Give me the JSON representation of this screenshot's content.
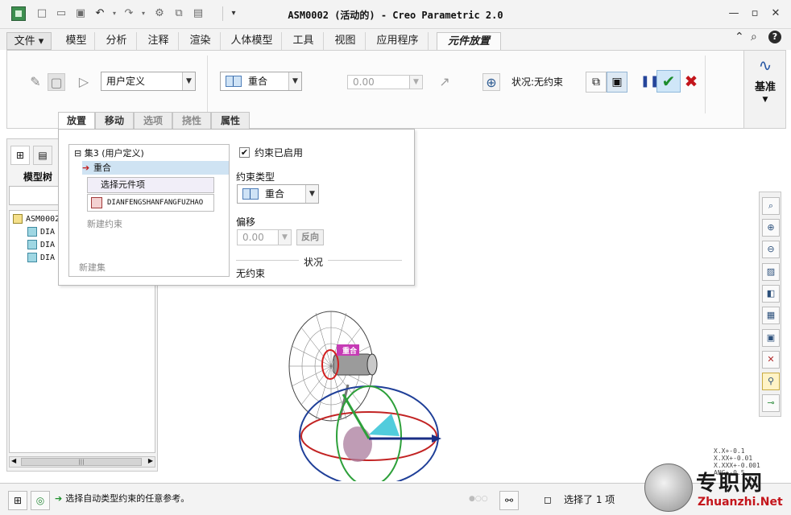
{
  "window": {
    "title": "ASM0002 (活动的) - Creo Parametric 2.0"
  },
  "ribbon_tabs": [
    {
      "label": "文件 ▾"
    },
    {
      "label": "模型"
    },
    {
      "label": "分析"
    },
    {
      "label": "注释"
    },
    {
      "label": "渲染"
    },
    {
      "label": "人体模型"
    },
    {
      "label": "工具"
    },
    {
      "label": "视图"
    },
    {
      "label": "应用程序"
    },
    {
      "label": "元件放置"
    }
  ],
  "ribbon": {
    "user_defined": "用户定义",
    "constraint_combo": "重合",
    "offset_value": "0.00",
    "status": "状况:无约束",
    "basis_label": "基准"
  },
  "sub_tabs": [
    {
      "label": "放置"
    },
    {
      "label": "移动"
    },
    {
      "label": "选项"
    },
    {
      "label": "挠性"
    },
    {
      "label": "属性"
    }
  ],
  "model_tree": {
    "title": "模型树",
    "root": "ASM0002",
    "items": [
      "DIA",
      "DIA",
      "DIA"
    ],
    "scroll_thumb": "|||"
  },
  "placement": {
    "set_header": "集3 (用户定义)",
    "selected_constraint": "重合",
    "pick_item": "选择元件项",
    "reference": "DIANFENGSHANFANGFUZHAO",
    "new_constraint": "新建约束",
    "new_set": "新建集",
    "enabled_label": "约束已启用",
    "type_label": "约束类型",
    "type_value": "重合",
    "offset_label": "偏移",
    "offset_value": "0.00",
    "reverse_label": "反向",
    "status_title": "状况",
    "status_value": "无约束"
  },
  "graphics": {
    "tag_label": "重合",
    "tolerances": [
      "X.X+-0.1",
      "X.XX+-0.01",
      "X.XXX+-0.001",
      "ANG+-0.5"
    ]
  },
  "statusbar": {
    "message": "选择自动类型约束的任意参考。",
    "selection": "选择了 1 项"
  },
  "watermark": {
    "cn": "专职网",
    "en": "Zhuanzhi.Net"
  },
  "colors": {
    "accent_blue": "#cfe3f3",
    "ok_green": "#1c8c2c",
    "cancel_red": "#c3151b",
    "tag_magenta": "#c63bb5"
  }
}
